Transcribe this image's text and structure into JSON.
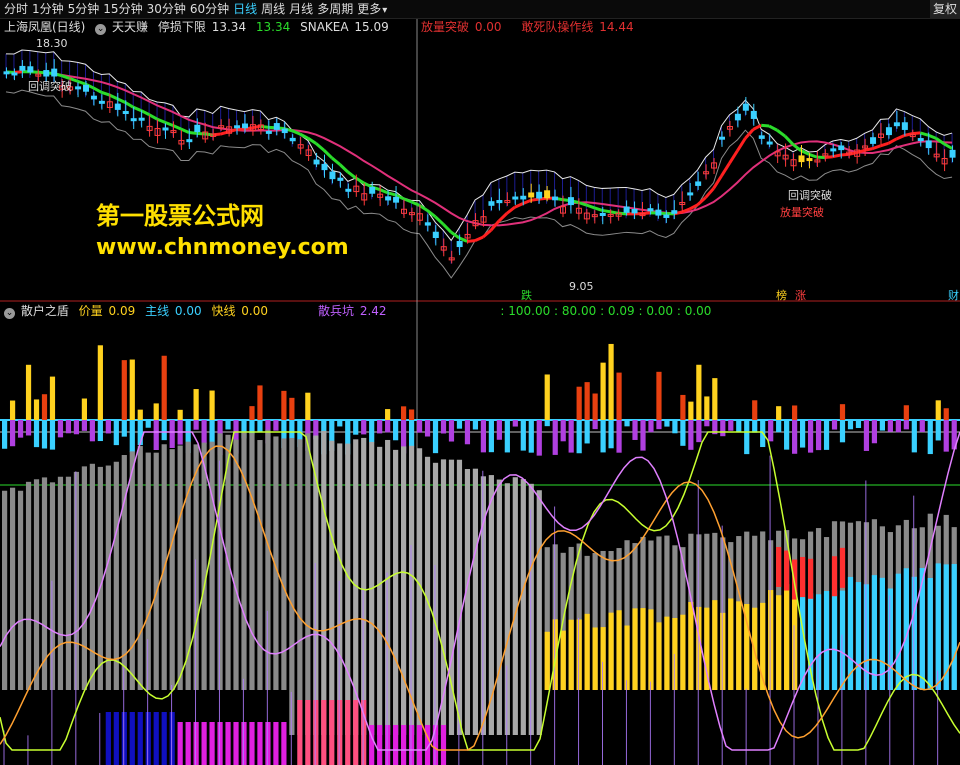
{
  "toolbar": {
    "items": [
      "分时",
      "1分钟",
      "5分钟",
      "15分钟",
      "30分钟",
      "60分钟",
      "日线",
      "周线",
      "月线",
      "多周期",
      "更多"
    ],
    "active": "日线",
    "corner_label": "复权"
  },
  "main_pane": {
    "stock_title": "上海凤凰(日线)",
    "indicator_name": "天天赚",
    "stop_loss_label": "停损下限",
    "stop_loss_value": "13.34",
    "value2": "13.34",
    "snakea_label": "SNAKEA",
    "snakea_value": "15.09",
    "breakout_label": "放量突破",
    "breakout_value": "0.00",
    "squad_label": "敢死队操作线",
    "squad_value": "14.44",
    "price_high_label": "18.30",
    "price_low_label": "9.05",
    "pullback_label_1": "回调突破",
    "pullback_label_2": "回调突破",
    "breakout_tag": "放量突破",
    "markers": {
      "die": "跌",
      "bang": "榜",
      "zhang": "涨",
      "cai": "财"
    }
  },
  "watermark": {
    "line1": "第一股票公式网",
    "line2": "www.chnmoney.com"
  },
  "sub_pane": {
    "indicator_name": "散户之盾",
    "volume_label": "价量",
    "volume_value": "0.09",
    "main_label": "主线",
    "main_value": "0.00",
    "fast_label": "快线",
    "fast_value": "0.00",
    "scatter_label": "散兵坑",
    "scatter_value": "2.42",
    "tail_values": ": 100.00 : 80.00 : 0.09 : 0.00 : 0.00"
  },
  "colors": {
    "up": "#ff3b3b",
    "down": "#3ad0ff",
    "yellow": "#ffd21f",
    "green_line": "#2bdc2b",
    "magenta_line": "#e0307a",
    "gray_bar": "#8a8a8a",
    "violet": "#b07cff"
  }
}
